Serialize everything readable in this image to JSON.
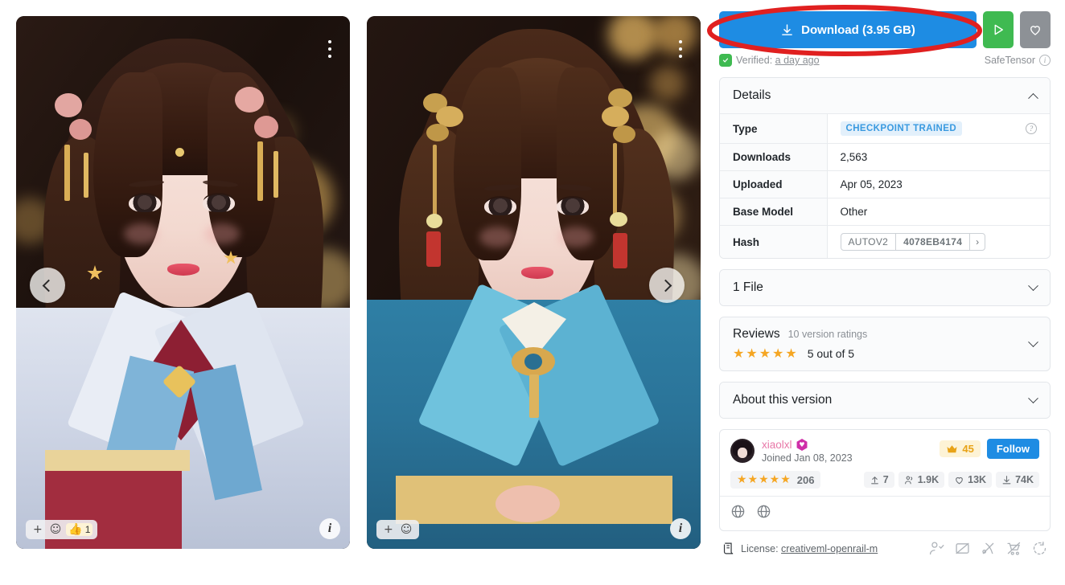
{
  "gallery": {
    "images": [
      {
        "alt": "portrait-hanfu-pink-floral",
        "menu_icon": "more-vertical-icon",
        "info_icon": "info-icon",
        "reactions": [
          {
            "icon": "plus-icon",
            "label": "+"
          },
          {
            "icon": "emoji-smile-icon",
            "label": "☺"
          },
          {
            "icon": "thumbs-up-icon",
            "label": "👍",
            "count": "1"
          }
        ]
      },
      {
        "alt": "portrait-hanfu-teal-gold",
        "menu_icon": "more-vertical-icon",
        "info_icon": "info-icon",
        "reactions": [
          {
            "icon": "plus-icon",
            "label": "+"
          },
          {
            "icon": "emoji-smile-icon",
            "label": "☺"
          }
        ]
      }
    ],
    "prev_label": "‹",
    "next_label": "›"
  },
  "download": {
    "label": "Download (3.95 GB)",
    "icon": "download-icon",
    "play_icon": "play-icon",
    "favorite_icon": "heart-icon",
    "accent_color": "#1e8ce3",
    "play_color": "#3fba51",
    "favorite_color": "#8d9196"
  },
  "verified": {
    "icon": "shield-check-icon",
    "prefix": "Verified:",
    "time": "a day ago",
    "format": "SafeTensor",
    "info_icon": "info-circle-icon"
  },
  "details": {
    "title": "Details",
    "collapse_icon": "chevron-up-icon",
    "rows": [
      {
        "key": "Type",
        "value": "CHECKPOINT TRAINED",
        "is_chip": true,
        "help_icon": "question-circle-icon"
      },
      {
        "key": "Downloads",
        "value": "2,563"
      },
      {
        "key": "Uploaded",
        "value": "Apr 05, 2023"
      },
      {
        "key": "Base Model",
        "value": "Other"
      },
      {
        "key": "Hash",
        "value": "",
        "hash_algo": "AUTOV2",
        "hash_value": "4078EB4174",
        "hash_more": "›"
      }
    ]
  },
  "files": {
    "title": "1 File",
    "expand_icon": "chevron-down-icon"
  },
  "reviews": {
    "title": "Reviews",
    "subtitle": "10 version ratings",
    "stars": "★★★★★",
    "score": "5 out of 5",
    "expand_icon": "chevron-down-icon"
  },
  "about": {
    "title": "About this version",
    "expand_icon": "chevron-down-icon"
  },
  "creator": {
    "avatar": "user-avatar",
    "name": "xiaolxl",
    "badge_icon": "heart-hexagon-badge-icon",
    "joined": "Joined Jan 08, 2023",
    "crown_icon": "crown-icon",
    "crown_count": "45",
    "follow_label": "Follow",
    "stars": "★★★★★",
    "rating_count": "206",
    "stats": [
      {
        "icon": "upload-icon",
        "value": "7"
      },
      {
        "icon": "followers-icon",
        "value": "1.9K"
      },
      {
        "icon": "heart-icon",
        "value": "13K"
      },
      {
        "icon": "download-icon",
        "value": "74K"
      }
    ],
    "links": [
      {
        "icon": "globe-icon"
      },
      {
        "icon": "globe-icon"
      }
    ]
  },
  "license": {
    "icon": "license-scroll-icon",
    "label": "License:",
    "name": "creativeml-openrail-m",
    "permissions": [
      {
        "icon": "no-credit-required-icon"
      },
      {
        "icon": "no-image-sell-icon"
      },
      {
        "icon": "no-merge-icon"
      },
      {
        "icon": "no-sell-icon"
      },
      {
        "icon": "no-different-license-icon"
      }
    ]
  },
  "annotation": {
    "shape": "ellipse",
    "color": "#e02020",
    "target": "download-button"
  }
}
